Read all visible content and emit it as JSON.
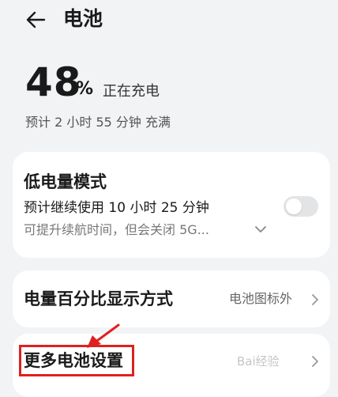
{
  "header": {
    "title": "电池",
    "back_icon": "arrow-left-icon"
  },
  "battery": {
    "percent": "48",
    "percent_sign": "%",
    "status": "正在充电",
    "eta": "预计 2 小时 55 分钟 充满"
  },
  "low_power": {
    "title": "低电量模式",
    "subtitle": "预计继续使用 10 小时 25 分钟",
    "description": "可提升续航时间，但会关闭 5G...",
    "toggle_on": false
  },
  "percent_mode": {
    "title": "电量百分比显示方式",
    "value": "电池图标外"
  },
  "more": {
    "title": "更多电池设置"
  },
  "annotation": {
    "color": "#e02020"
  },
  "watermark": {
    "text": "Bai经验"
  }
}
